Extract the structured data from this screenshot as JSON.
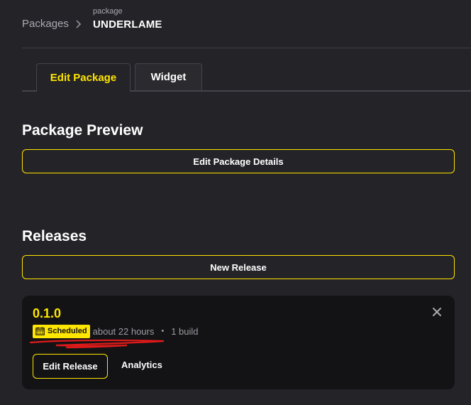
{
  "breadcrumb": {
    "root": "Packages",
    "current_caption": "package",
    "current": "UNDERLAME"
  },
  "tabs": [
    {
      "label": "Edit Package",
      "active": true
    },
    {
      "label": "Widget",
      "active": false
    }
  ],
  "preview": {
    "heading": "Package Preview",
    "edit_details_label": "Edit Package Details"
  },
  "releases": {
    "heading": "Releases",
    "new_release_label": "New Release",
    "items": [
      {
        "version": "0.1.0",
        "status": "Scheduled",
        "time": "about 22 hours",
        "separator": "•",
        "builds": "1 build",
        "edit_label": "Edit Release",
        "analytics_label": "Analytics"
      }
    ]
  },
  "colors": {
    "accent": "#ffe600",
    "background": "#242328",
    "card": "#131316",
    "annotation": "#e01a1a"
  },
  "icons": [
    "chevron-right-icon",
    "calendar-icon",
    "close-icon"
  ]
}
